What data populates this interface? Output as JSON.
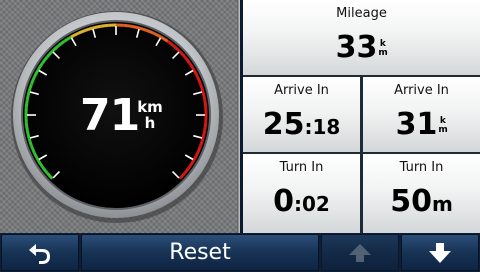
{
  "gauge": {
    "speed": "71",
    "unit_top": "km",
    "unit_bottom": "h",
    "colors": {
      "green": "#2fbf2f",
      "yellow": "#e0b02a",
      "orange": "#e06020",
      "red": "#d01818",
      "face": "#000000",
      "bezel": "#cfd2d4"
    }
  },
  "fields": {
    "mileage": {
      "label": "Mileage",
      "value": "33",
      "unit_top": "k",
      "unit_bottom": "m"
    },
    "arrive_time": {
      "label": "Arrive In",
      "value_main": "25",
      "value_sep": ":",
      "value_small": "18"
    },
    "arrive_dist": {
      "label": "Arrive In",
      "value": "31",
      "unit_top": "k",
      "unit_bottom": "m"
    },
    "turn_time": {
      "label": "Turn In",
      "value_main": "0",
      "value_sep": ":",
      "value_small": "02"
    },
    "turn_dist": {
      "label": "Turn In",
      "value": "50",
      "unit": "m"
    }
  },
  "toolbar": {
    "back_icon": "back-arrow-icon",
    "reset_label": "Reset",
    "up_icon": "arrow-up-icon",
    "down_icon": "arrow-down-icon",
    "up_enabled": false,
    "down_enabled": true
  }
}
